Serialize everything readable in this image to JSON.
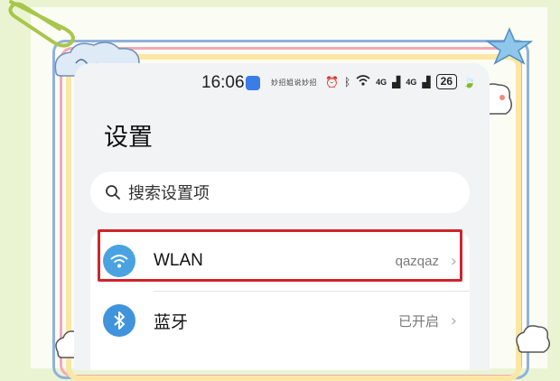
{
  "status_bar": {
    "time": "16:06",
    "app_text": "妙招姐说妙招",
    "signal1": "4G",
    "signal2": "4G",
    "battery": "26"
  },
  "page_title": "设置",
  "search": {
    "placeholder": "搜索设置项"
  },
  "settings": [
    {
      "label": "WLAN",
      "value": "qazqaz",
      "icon": "wifi-icon",
      "highlighted": true
    },
    {
      "label": "蓝牙",
      "value": "已开启",
      "icon": "bluetooth-icon",
      "highlighted": false
    }
  ],
  "colors": {
    "highlight": "#d0232a",
    "wifi_icon_bg": "#4aa3e0",
    "bluetooth_icon_bg": "#3f94dc",
    "page_bg": "#eaf4d3"
  }
}
